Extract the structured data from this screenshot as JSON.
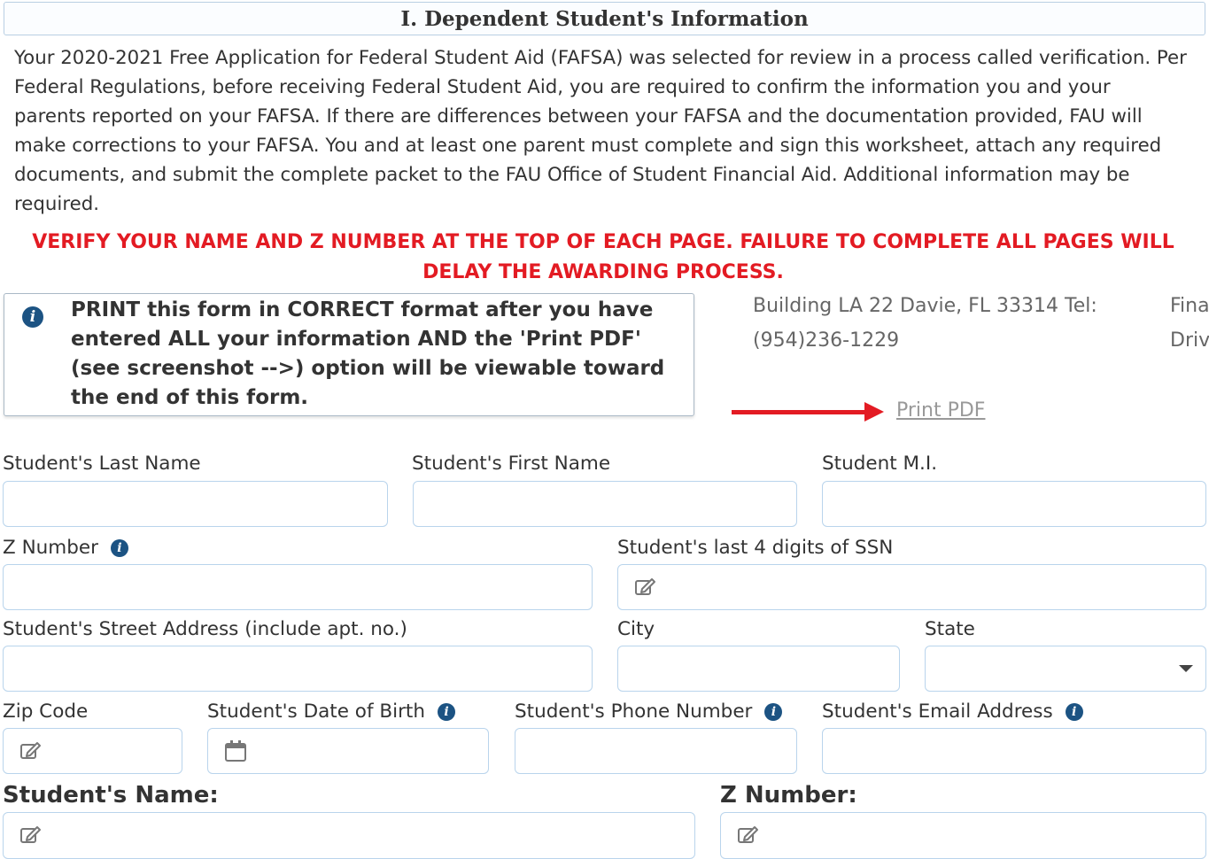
{
  "section": {
    "title": "I. Dependent Student's Information"
  },
  "intro": "Your 2020-2021 Free Application for Federal Student Aid (FAFSA) was selected for review in a process called verification. Per Federal Regulations, before receiving Federal Student Aid, you are required to confirm the information you and your parents reported on your FAFSA. If there are differences between your FAFSA and the documentation provided, FAU will make corrections to your FAFSA. You and at least one parent must complete and sign this worksheet, attach any required documents, and submit the complete packet to the FAU Office of Student Financial Aid. Additional information may be required.",
  "warning": "VERIFY YOUR NAME AND Z NUMBER AT THE TOP OF EACH PAGE. FAILURE TO COMPLETE ALL PAGES WILL DELAY THE AWARDING PROCESS.",
  "info_box": {
    "icon": "info-icon",
    "text": "PRINT this form in CORRECT format after you have entered ALL your information AND the 'Print PDF' (see screenshot -->) option will be viewable toward the end of this form."
  },
  "screenshot_preview": {
    "address": "Building LA 22 Davie, FL 33314 Tel: (954)236-1229",
    "clipped_line1": "Fina",
    "clipped_line2": "Driv",
    "print_link": "Print PDF",
    "arrow_color": "#e31b23"
  },
  "fields": {
    "last_name": {
      "label": "Student's Last Name",
      "value": ""
    },
    "first_name": {
      "label": "Student's First Name",
      "value": ""
    },
    "mi": {
      "label": "Student M.I.",
      "value": ""
    },
    "z_number": {
      "label": "Z Number",
      "value": ""
    },
    "ssn": {
      "label": "Student's last 4 digits of SSN",
      "value": ""
    },
    "street": {
      "label": "Student's Street Address (include apt. no.)",
      "value": ""
    },
    "city": {
      "label": "City",
      "value": ""
    },
    "state": {
      "label": "State",
      "value": ""
    },
    "zip": {
      "label": "Zip Code",
      "value": ""
    },
    "dob": {
      "label": "Student's Date of Birth",
      "value": ""
    },
    "phone": {
      "label": "Student's Phone Number",
      "value": ""
    },
    "email": {
      "label": "Student's Email Address",
      "value": ""
    }
  },
  "footer": {
    "name_label": "Student's Name:",
    "z_label": "Z Number:"
  },
  "colors": {
    "warning": "#e31b23",
    "info_icon": "#1c5383",
    "field_border": "#b9d4ec"
  }
}
